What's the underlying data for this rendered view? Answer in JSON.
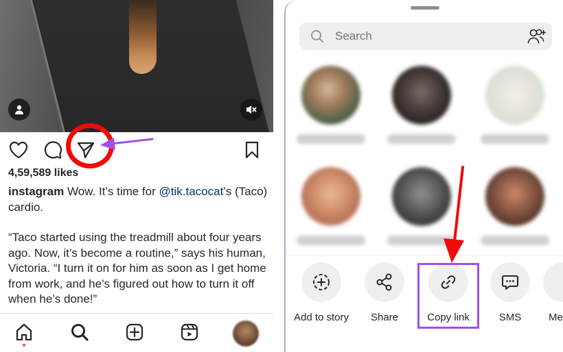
{
  "left": {
    "likes": "4,59,589 likes",
    "caption": {
      "user": "instagram",
      "text_before": " Wow. It’s time for ",
      "mention": "@tik.tacocat",
      "text_after": "’s (Taco) cardio."
    },
    "quote": "“Taco started using the treadmill about four years ago. Now, it’s become a routine,” says his human, Victoria. “I turn it on for him as soon as I get home from work, and he’s figured out how to turn it off when he’s done!”",
    "icons": {
      "profile": "profile-icon",
      "mute": "mute-icon",
      "like": "heart-icon",
      "comment": "comment-icon",
      "share": "send-icon",
      "save": "bookmark-icon"
    },
    "nav": [
      "home-icon",
      "search-icon",
      "add-icon",
      "reels-icon",
      "profile-avatar"
    ]
  },
  "right": {
    "search_placeholder": "Search",
    "share_options": [
      {
        "label": "Add to story",
        "icon": "add-story-icon"
      },
      {
        "label": "Share",
        "icon": "share-nodes-icon"
      },
      {
        "label": "Copy link",
        "icon": "link-icon"
      },
      {
        "label": "SMS",
        "icon": "sms-icon"
      },
      {
        "label": "Me",
        "icon": "messenger-icon"
      }
    ]
  },
  "colors": {
    "annotation_red": "#f00a0a",
    "annotation_purple": "#a34ee6",
    "mention_blue": "#00376b"
  }
}
